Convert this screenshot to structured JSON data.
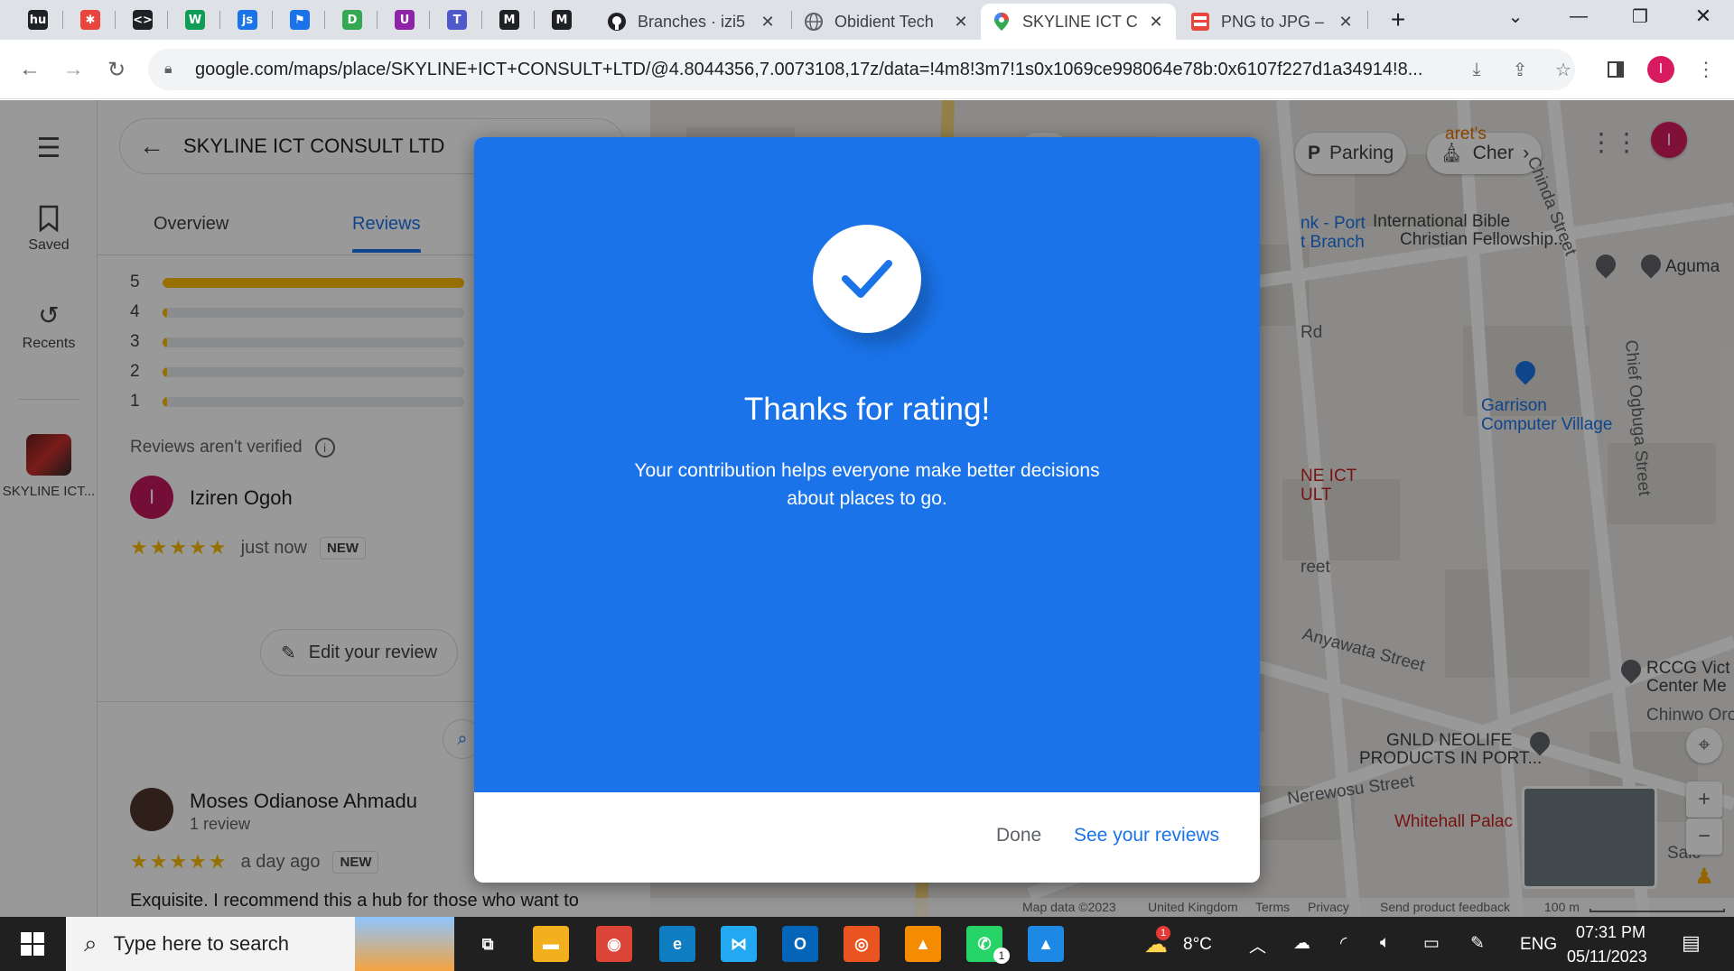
{
  "browser": {
    "pinned_tabs": [
      {
        "icon": "hu-icon",
        "glyph": "hu",
        "color": "#202124"
      },
      {
        "icon": "puzzle-icon",
        "glyph": "✱",
        "color": "#e8453c"
      },
      {
        "icon": "tag-icon",
        "glyph": "<>",
        "color": "#202124"
      },
      {
        "icon": "w-icon",
        "glyph": "W",
        "color": "#0f9d58"
      },
      {
        "icon": "js-icon",
        "glyph": "js",
        "color": "#1a73e8"
      },
      {
        "icon": "flag-icon",
        "glyph": "⚑",
        "color": "#1a73e8"
      },
      {
        "icon": "d-icon",
        "glyph": "D",
        "color": "#34a853"
      },
      {
        "icon": "u-icon",
        "glyph": "U",
        "color": "#8e24aa"
      },
      {
        "icon": "teams-icon",
        "glyph": "T",
        "color": "#5059c9"
      },
      {
        "icon": "medium-icon",
        "glyph": "M",
        "color": "#202124"
      },
      {
        "icon": "medium-icon-2",
        "glyph": "M",
        "color": "#202124"
      }
    ],
    "tabs": [
      {
        "title": "Branches · izi5",
        "icon": "github-icon"
      },
      {
        "title": "Obidient Tech",
        "icon": "globe-icon"
      },
      {
        "title": "SKYLINE ICT C",
        "icon": "maps-pin-icon"
      },
      {
        "title": "PNG to JPG –",
        "icon": "png-jpg-icon"
      }
    ],
    "url": "google.com/maps/place/SKYLINE+ICT+CONSULT+LTD/@4.8044356,7.0073108,17z/data=!4m8!3m7!1s0x1069ce998064e78b:0x6107f227d1a34914!8...",
    "profile_initial": "I"
  },
  "rail": {
    "saved": "Saved",
    "recents": "Recents",
    "place": "SKYLINE ICT..."
  },
  "panel": {
    "title": "SKYLINE ICT CONSULT LTD",
    "tabs": [
      "Overview",
      "Reviews"
    ],
    "rating_rows": [
      {
        "label": "5",
        "fill": 1.0
      },
      {
        "label": "4",
        "fill": 0.0
      },
      {
        "label": "3",
        "fill": 0.0
      },
      {
        "label": "2",
        "fill": 0.0
      },
      {
        "label": "1",
        "fill": 0.0
      }
    ],
    "verified_note": "Reviews aren't verified",
    "my_review": {
      "author": "Iziren Ogoh",
      "initial": "I",
      "stars": "★★★★★",
      "time": "just now",
      "badge": "NEW",
      "edit_label": "Edit your review"
    },
    "other_review": {
      "author": "Moses Odianose Ahmadu",
      "count": "1 review",
      "stars": "★★★★★",
      "time": "a day ago",
      "badge": "NEW",
      "text": "Exquisite. I recommend this a hub for those who want to"
    }
  },
  "map": {
    "chips": [
      "Parking",
      "Cher"
    ],
    "labels": [
      {
        "text": "International Bible",
        "color": "#3c4043"
      },
      {
        "text": "Christian Fellowship...",
        "color": "#3c4043"
      },
      {
        "text": "Aguma",
        "color": "#3c4043"
      },
      {
        "text": "Garrison",
        "color": "#1a73e8"
      },
      {
        "text": "Computer Village",
        "color": "#1a73e8"
      },
      {
        "text": "Anyawata Street",
        "color": "#5f6368"
      },
      {
        "text": "RCCG Vict",
        "color": "#3c4043"
      },
      {
        "text": "Center Me",
        "color": "#3c4043"
      },
      {
        "text": "GNLD NEOLIFE",
        "color": "#3c4043"
      },
      {
        "text": "PRODUCTS IN PORT...",
        "color": "#3c4043"
      },
      {
        "text": "Nerewosu Street",
        "color": "#5f6368"
      },
      {
        "text": "Whitehall Palac",
        "color": "#c5221f"
      },
      {
        "text": "Chinda Street",
        "color": "#5f6368"
      },
      {
        "text": "Chief Ogbuga Street",
        "color": "#5f6368"
      },
      {
        "text": "nk - Port",
        "color": "#1a73e8"
      },
      {
        "text": "t Branch",
        "color": "#1a73e8"
      },
      {
        "text": "NE ICT",
        "color": "#c5221f"
      },
      {
        "text": "ULT",
        "color": "#c5221f"
      },
      {
        "text": "aret's",
        "color": "#e37400"
      },
      {
        "text": "Rd",
        "color": "#5f6368"
      },
      {
        "text": "reet",
        "color": "#5f6368"
      },
      {
        "text": "Chinwo Oro",
        "color": "#5f6368"
      },
      {
        "text": "Salc",
        "color": "#5f6368"
      },
      {
        "text": "t",
        "color": "#3c4043"
      }
    ],
    "footer": [
      "Map data ©2023",
      "United Kingdom",
      "Terms",
      "Privacy",
      "Send product feedback",
      "100 m"
    ]
  },
  "dialog": {
    "title": "Thanks for rating!",
    "message": "Your contribution helps everyone make better decisions about places to go.",
    "done_label": "Done",
    "see_label": "See your reviews"
  },
  "taskbar": {
    "search_placeholder": "Type here to search",
    "apps": [
      {
        "icon": "task-view-icon",
        "glyph": "⧉",
        "color": "#202020"
      },
      {
        "icon": "file-explorer-icon",
        "glyph": "▬",
        "color": "#f2b01e"
      },
      {
        "icon": "chrome-icon",
        "glyph": "◉",
        "color": "#db4437"
      },
      {
        "icon": "edge-icon",
        "glyph": "e",
        "color": "#0f7dc2"
      },
      {
        "icon": "vscode-icon",
        "glyph": "⋈",
        "color": "#23a9f2"
      },
      {
        "icon": "outlook-icon",
        "glyph": "O",
        "color": "#0364b8"
      },
      {
        "icon": "ubuntu-icon",
        "glyph": "◎",
        "color": "#e95420"
      },
      {
        "icon": "vlc-icon",
        "glyph": "▲",
        "color": "#f48b00"
      },
      {
        "icon": "whatsapp-icon",
        "glyph": "✆",
        "color": "#25d366"
      },
      {
        "icon": "photos-icon",
        "glyph": "▲",
        "color": "#1e88e5"
      }
    ],
    "weather": "8°C",
    "weather_badge": "1",
    "whatsapp_badge": "1",
    "language": "ENG",
    "time": "07:31 PM",
    "date": "05/11/2023"
  }
}
